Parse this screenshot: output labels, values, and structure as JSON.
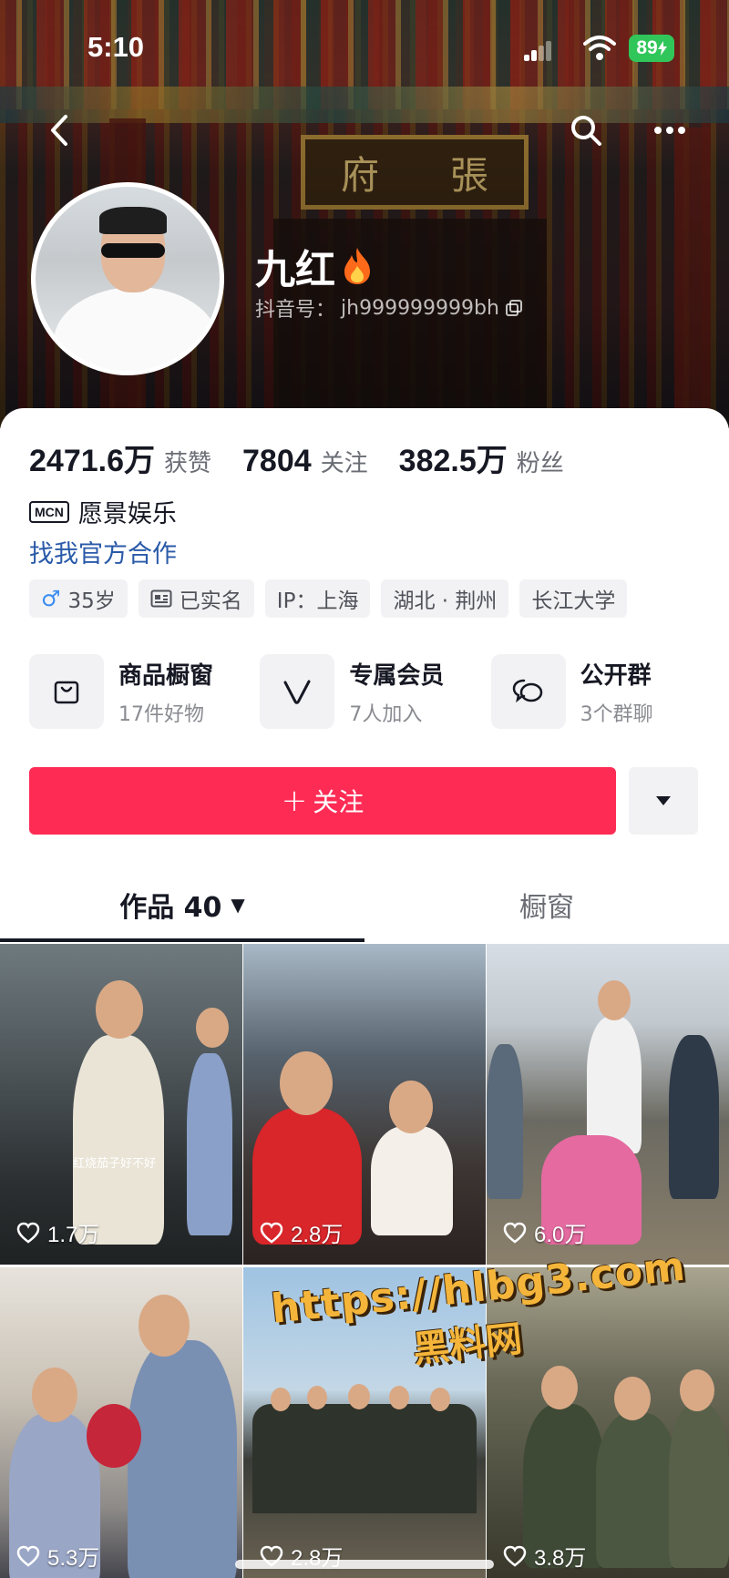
{
  "status_bar": {
    "time": "5:10",
    "battery": "89"
  },
  "header": {
    "plaque_chars": [
      "府",
      "張"
    ],
    "display_name": "九红",
    "douyin_id_label": "抖音号：",
    "douyin_id": "jh999999999bh"
  },
  "stats": [
    {
      "value": "2471.6万",
      "label": "获赞"
    },
    {
      "value": "7804",
      "label": "关注"
    },
    {
      "value": "382.5万",
      "label": "粉丝"
    }
  ],
  "profile": {
    "mcn_badge": "MCN",
    "mcn_name": "愿景娱乐",
    "cooperate_link": "找我官方合作"
  },
  "tags": [
    {
      "text": "35岁",
      "icon": "male-icon"
    },
    {
      "text": "已实名",
      "icon": "id-card-icon"
    },
    {
      "text": "IP：上海"
    },
    {
      "text": "湖北 · 荆州"
    },
    {
      "text": "长江大学"
    }
  ],
  "features": [
    {
      "title": "商品橱窗",
      "subtitle": "17件好物",
      "icon": "shopping-bag-icon"
    },
    {
      "title": "专属会员",
      "subtitle": "7人加入",
      "icon": "member-v-icon"
    },
    {
      "title": "公开群",
      "subtitle": "3个群聊",
      "icon": "chat-bubbles-icon"
    }
  ],
  "actions": {
    "follow_label": "关注",
    "follow_plus": "+"
  },
  "tabs": {
    "works_label": "作品 40",
    "shop_label": "橱窗"
  },
  "videos": [
    {
      "likes": "1.7万",
      "caption": "红烧茄子好不好"
    },
    {
      "likes": "2.8万"
    },
    {
      "likes": "6.0万"
    },
    {
      "likes": "5.3万"
    },
    {
      "likes": "2.8万"
    },
    {
      "likes": "3.8万"
    }
  ],
  "watermark": {
    "url": "https://hlbg3.com",
    "name": "黑料网"
  },
  "colors": {
    "accent": "#fe2c55",
    "link": "#2a5aa8",
    "battery": "#31c65a"
  }
}
